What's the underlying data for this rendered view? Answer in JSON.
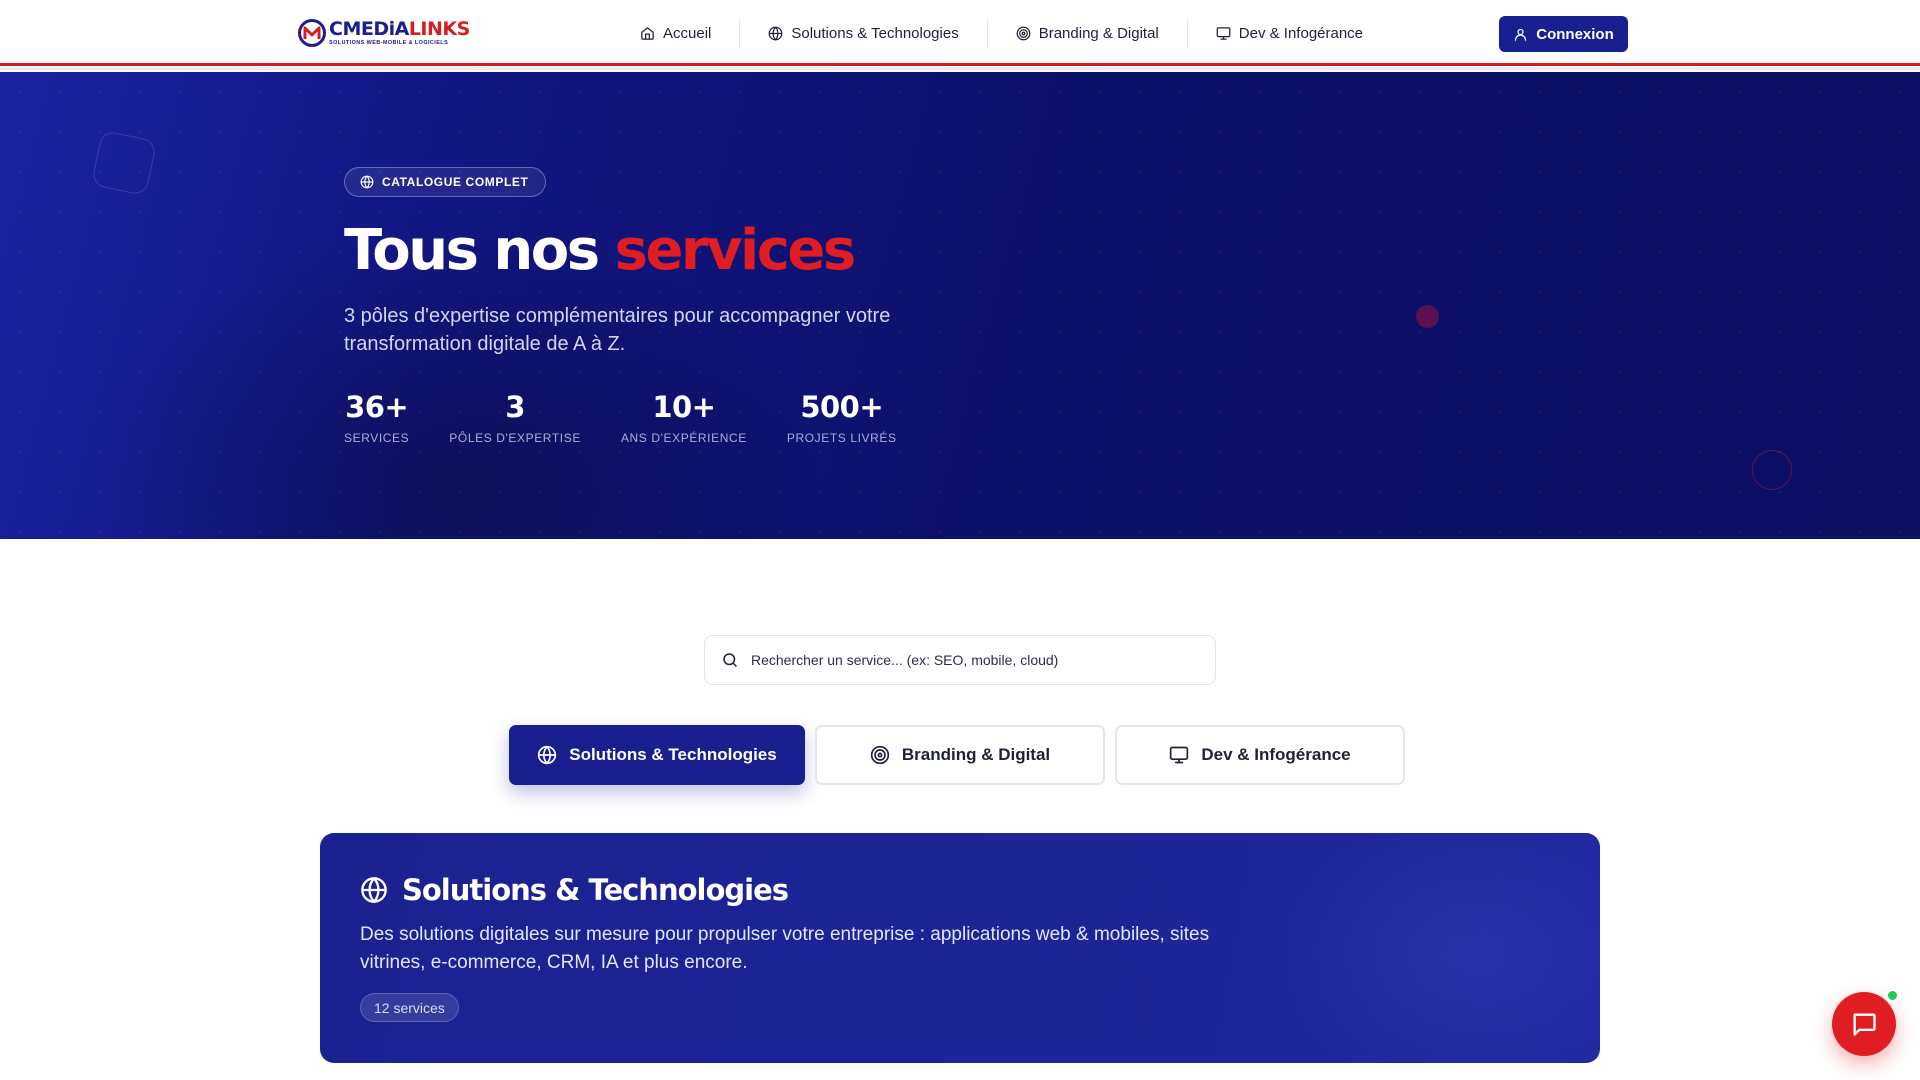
{
  "brand": {
    "name_part1": "CMEDiA",
    "name_part2": "LINKS",
    "tagline": "SOLUTIONS WEB-MOBILE & LOGICIELS"
  },
  "nav": {
    "items": [
      {
        "label": "Accueil",
        "icon": "home-icon"
      },
      {
        "label": "Solutions & Technologies",
        "icon": "globe-icon"
      },
      {
        "label": "Branding & Digital",
        "icon": "target-icon"
      },
      {
        "label": "Dev & Infogérance",
        "icon": "monitor-icon"
      }
    ],
    "login_label": "Connexion"
  },
  "hero": {
    "badge": "CATALOGUE COMPLET",
    "title_main": "Tous nos ",
    "title_accent": "services",
    "subtitle": "3 pôles d'expertise complémentaires pour accompagner votre transformation digitale de A à Z.",
    "stats": [
      {
        "value": "36+",
        "label": "SERVICES"
      },
      {
        "value": "3",
        "label": "PÔLES D'EXPERTISE"
      },
      {
        "value": "10+",
        "label": "ANS D'EXPÉRIENCE"
      },
      {
        "value": "500+",
        "label": "PROJETS LIVRÉS"
      }
    ]
  },
  "search": {
    "placeholder": "Rechercher un service... (ex: SEO, mobile, cloud)",
    "value": ""
  },
  "tabs": [
    {
      "label": "Solutions & Technologies",
      "icon": "globe-icon",
      "active": true
    },
    {
      "label": "Branding & Digital",
      "icon": "target-icon",
      "active": false
    },
    {
      "label": "Dev & Infogérance",
      "icon": "monitor-icon",
      "active": false
    }
  ],
  "section": {
    "title": "Solutions & Technologies",
    "description": "Des solutions digitales sur mesure pour propulser votre entreprise : applications web & mobiles, sites vitrines, e-commerce, CRM, IA et plus encore.",
    "count": "12 services"
  },
  "colors": {
    "primary": "#1a1f8f",
    "accent": "#e11d24",
    "online": "#22c55e"
  }
}
